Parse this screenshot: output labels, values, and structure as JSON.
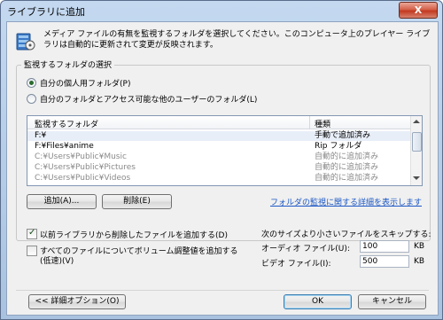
{
  "window": {
    "title": "ライブラリに追加",
    "close_label": "X"
  },
  "header": {
    "icon": "media-library-icon",
    "description": "メディア ファイルの有無を監視するフォルダを選択してください。このコンピュータ上のプレイヤー ライブラリは自動的に更新されて変更が反映されます。"
  },
  "folder_group": {
    "label": "監視するフォルダの選択",
    "options": [
      {
        "label": "自分の個人用フォルダ(P)",
        "selected": true
      },
      {
        "label": "自分のフォルダとアクセス可能な他のユーザーのフォルダ(L)",
        "selected": false
      }
    ],
    "list": {
      "columns": [
        "監視するフォルダ",
        "種類"
      ],
      "rows": [
        {
          "folder": "F:¥",
          "type": "手動で追加済み",
          "dim": false
        },
        {
          "folder": "F:¥Files¥anime",
          "type": "Rip フォルダ",
          "dim": false
        },
        {
          "folder": "C:¥Users¥Public¥Music",
          "type": "自動的に追加済み",
          "dim": true
        },
        {
          "folder": "C:¥Users¥Public¥Pictures",
          "type": "自動的に追加済み",
          "dim": true
        },
        {
          "folder": "C:¥Users¥Public¥Videos",
          "type": "自動的に追加済み",
          "dim": true
        }
      ]
    },
    "add_label": "追加(A)...",
    "remove_label": "削除(E)",
    "details_link": "フォルダの監視に関する詳細を表示します"
  },
  "options": {
    "readd_deleted": {
      "label": "以前ライブラリから削除したファイルを追加する(D)",
      "checked": true
    },
    "volume_leveling": {
      "label_line1": "すべてのファイルについてボリューム調整値を追加する",
      "label_line2": "(低速)(V)",
      "checked": false
    }
  },
  "skip": {
    "label": "次のサイズより小さいファイルをスキップする:",
    "audio_label": "オーディオ ファイル(U):",
    "audio_value": "100",
    "video_label": "ビデオ ファイル(I):",
    "video_value": "500",
    "unit": "KB"
  },
  "footer": {
    "advanced_label": "<< 詳細オプション(O)",
    "ok_label": "OK",
    "cancel_label": "キャンセル"
  }
}
